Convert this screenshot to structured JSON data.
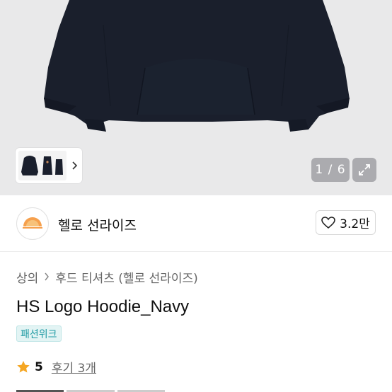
{
  "gallery": {
    "counter": "1 / 6",
    "thumbnail_icon": "hoodie-thumbnail",
    "next_icon": "chevron-right-icon",
    "expand_icon": "expand-icon"
  },
  "seller": {
    "name": "헬로 선라이즈",
    "likes": "3.2만",
    "like_icon": "heart-icon"
  },
  "breadcrumb": {
    "items": [
      "상의",
      "후드 티셔츠 (헬로 선라이즈)"
    ]
  },
  "product": {
    "title": "HS Logo Hoodie_Navy",
    "badge": "패션위크",
    "rating": "5",
    "reviews": "후기 3개",
    "star_icon": "star-icon"
  },
  "colors": {
    "hero_bg": "#e9e9ea",
    "hoodie": "#1a1f2c",
    "badge_text": "#1f9aa3",
    "star": "#f5a623"
  }
}
